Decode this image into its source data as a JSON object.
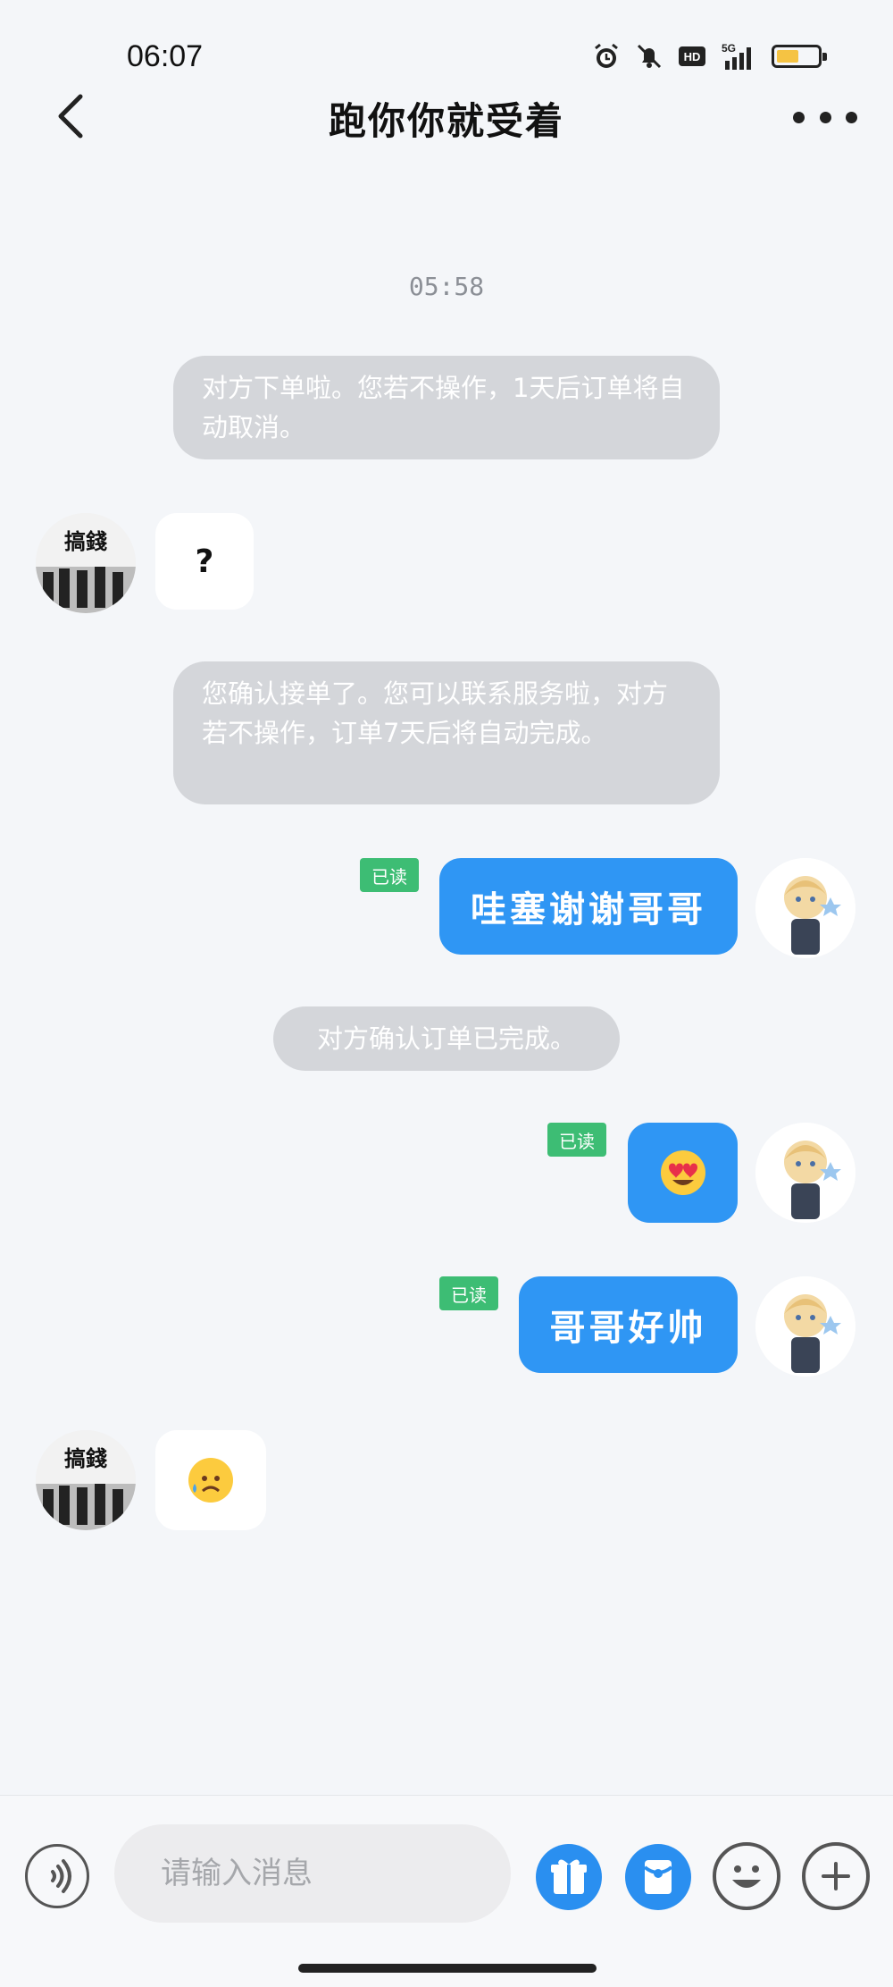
{
  "status_bar": {
    "time": "06:07",
    "network": "5G",
    "hd_label": "HD",
    "icons": [
      "alarm-icon",
      "mute-bell-icon",
      "hd-icon",
      "signal-5g-icon",
      "battery-icon"
    ],
    "battery_level": 0.55
  },
  "header": {
    "title": "跑你你就受着",
    "back_icon": "chevron-left-icon",
    "more_icon": "more-dots-icon"
  },
  "chat": {
    "timestamp": "05:58",
    "system_messages": [
      "对方下单啦。您若不操作，1天后订单将自动取消。",
      "您确认接单了。您可以联系服务啦，对方若不操作，订单7天后将自动完成。",
      "对方确认订单已完成。"
    ],
    "other_avatar_text": "搞錢",
    "messages": [
      {
        "from": "other",
        "text": "?"
      },
      {
        "from": "self",
        "text": "哇塞谢谢哥哥",
        "read": "已读"
      },
      {
        "from": "self",
        "emoji": "heart-eyes-face",
        "read": "已读"
      },
      {
        "from": "self",
        "text": "哥哥好帅",
        "read": "已读"
      },
      {
        "from": "other",
        "emoji": "sad-sweat-face"
      }
    ]
  },
  "input_bar": {
    "placeholder": "请输入消息",
    "voice_icon": "voice-icon",
    "gift_icon": "gift-icon",
    "redpacket_icon": "red-packet-icon",
    "emoji_icon": "emoji-icon",
    "plus_icon": "plus-icon"
  },
  "colors": {
    "self_bubble": "#2f96f4",
    "read_tag": "#3dbd74",
    "system_bubble": "#d4d6da",
    "background": "#f4f6f9"
  }
}
